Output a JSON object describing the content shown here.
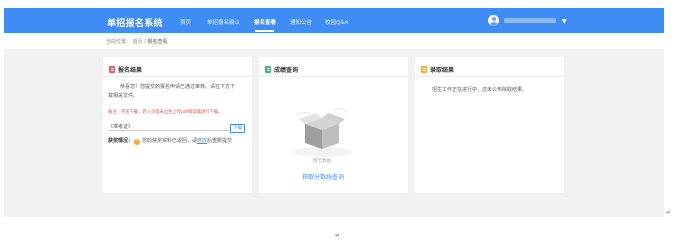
{
  "nav": {
    "brand": "单招报名系统",
    "items": [
      {
        "label": "首页",
        "active": false
      },
      {
        "label": "单招报名确认",
        "active": false
      },
      {
        "label": "报名查看",
        "active": true
      },
      {
        "label": "通知公告",
        "active": false
      },
      {
        "label": "校园Q&A",
        "active": false
      }
    ],
    "caret": "▼"
  },
  "breadcrumb": {
    "prefix": "当前位置：",
    "home": "首页",
    "separator": "/",
    "current": "报名查看"
  },
  "cards": {
    "result": {
      "title": "报名结果",
      "icon": "document-red-icon",
      "icon_color": "#ec5b5b",
      "message_line1": "恭喜您！您提交的报名申请已通过审核。请在下方下",
      "message_line2": "载相关文件。",
      "notice": "备注：点击下载，若入页面未出生上传pdf阅读器进行下载。",
      "file_label": "《准考证》",
      "download_label": "下载",
      "award_label": "获奖情况：",
      "award_text": "您的获奖资料已退回，请",
      "award_link": "修改",
      "award_suffix": "后重新提交"
    },
    "score": {
      "title": "成绩查询",
      "icon": "document-green-icon",
      "icon_color": "#3cb878",
      "empty_text": "暂无数据",
      "query_link": "获取分数线查询"
    },
    "admission": {
      "title": "录取结果",
      "icon": "document-yellow-icon",
      "icon_color": "#f2b134",
      "message": "招生工作正在进行中，还未公布除取结果。"
    }
  },
  "return_mark": "↵",
  "colors": {
    "accent": "#3f8cf4",
    "notice": "#e24b4b",
    "page_bg": "#f1f1f1"
  }
}
